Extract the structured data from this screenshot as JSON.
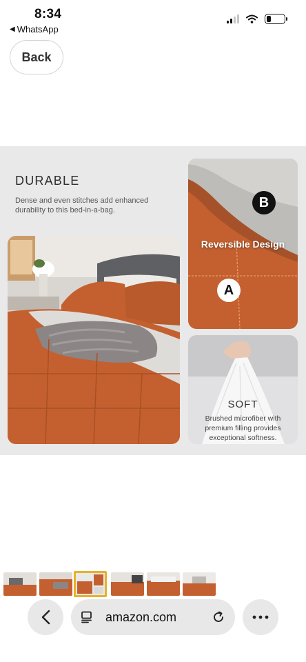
{
  "status_bar": {
    "time": "8:34",
    "return_app": "WhatsApp",
    "icons": [
      "signal-icon",
      "wifi-icon",
      "battery-icon"
    ]
  },
  "back_button": {
    "label": "Back"
  },
  "product_panel": {
    "durable": {
      "title": "DURABLE",
      "description": "Dense and even stitches add enhanced durability to this bed-in-a-bag."
    },
    "reversible": {
      "label": "Reversible Design",
      "side_b": "B",
      "side_a": "A"
    },
    "soft": {
      "title": "SOFT",
      "description": "Brushed microfiber with premium filling provides exceptional softness."
    }
  },
  "thumbnails": {
    "count": 6,
    "selected_index": 2
  },
  "browser_bar": {
    "url": "amazon.com",
    "icons": [
      "chevron-left-icon",
      "tabs-icon",
      "reload-icon",
      "more-icon"
    ]
  },
  "colors": {
    "accent_orange": "#c4602f",
    "selected_thumb_border": "#e8b12a",
    "panel_background": "#e9e9e9"
  }
}
